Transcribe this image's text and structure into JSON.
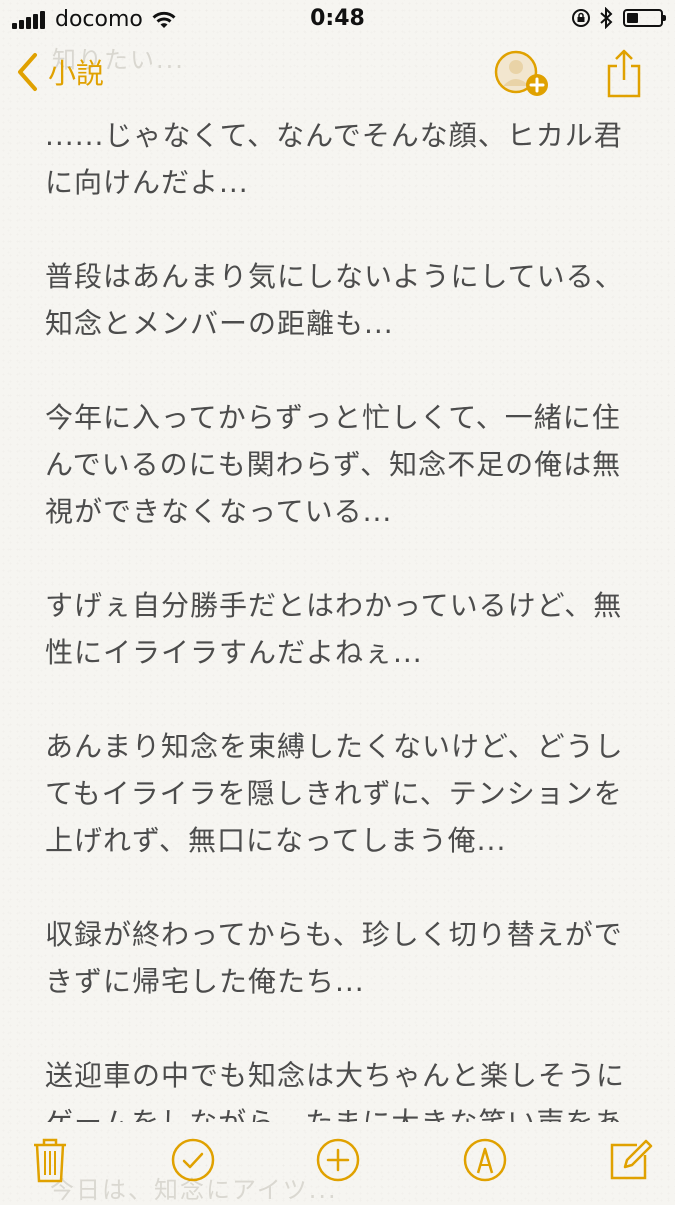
{
  "status_bar": {
    "carrier": "docomo",
    "time": "0:48",
    "battery_level": 0.35
  },
  "nav": {
    "back_label": "小説",
    "ghost_title": "知りたい..."
  },
  "note": {
    "paragraphs": [
      "......じゃなくて、なんでそんな顔、ヒカル君に向けんだよ...",
      "普段はあんまり気にしないようにしている、知念とメンバーの距離も...",
      "今年に入ってからずっと忙しくて、一緒に住んでいるのにも関わらず、知念不足の俺は無視ができなくなっている...",
      "すげぇ自分勝手だとはわかっているけど、無性にイライラすんだよねぇ...",
      "あんまり知念を束縛したくないけど、どうしてもイライラを隠しきれずに、テンションを上げれず、無口になってしまう俺...",
      "収録が終わってからも、珍しく切り替えができずに帰宅した俺たち...",
      "送迎車の中でも知念は大ちゃんと楽しそうにゲームをしながら、たまに大きな笑い声をあげる度にちょっと癇に触ったりして..."
    ],
    "ghost_bottom": "今日は、知念にアイツ..."
  },
  "colors": {
    "accent": "#e0a100",
    "text": "#4c4c4c",
    "paper": "#f6f5f1"
  },
  "toolbar": {
    "icons": [
      "trash-icon",
      "checklist-icon",
      "add-icon",
      "markup-icon",
      "compose-icon"
    ]
  }
}
